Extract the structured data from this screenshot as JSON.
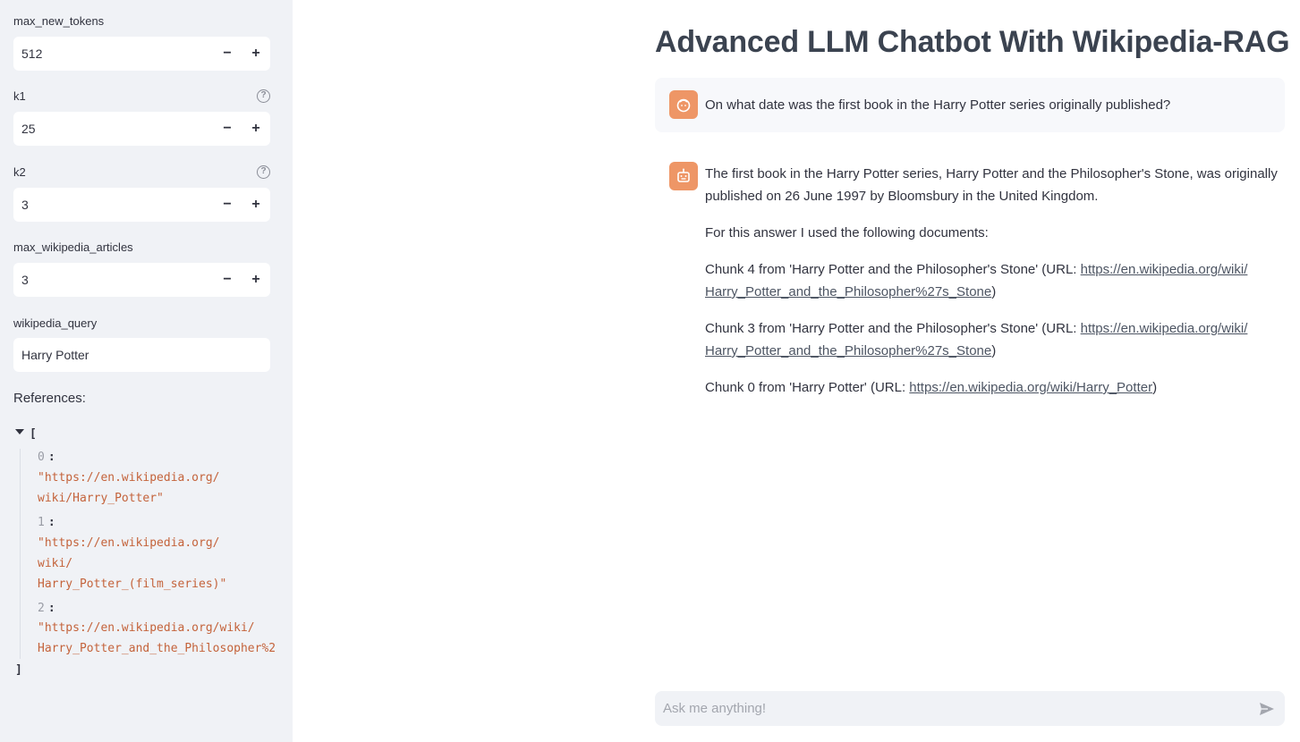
{
  "sidebar": {
    "max_new_tokens": {
      "label": "max_new_tokens",
      "value": "512"
    },
    "k1": {
      "label": "k1",
      "value": "25",
      "help": "?"
    },
    "k2": {
      "label": "k2",
      "value": "3",
      "help": "?"
    },
    "max_wikipedia_articles": {
      "label": "max_wikipedia_articles",
      "value": "3"
    },
    "wikipedia_query": {
      "label": "wikipedia_query",
      "value": "Harry Potter"
    },
    "stepper": {
      "minus": "−",
      "plus": "+"
    },
    "references": {
      "label": "References:",
      "open_bracket": "[",
      "close_bracket": "]",
      "items": [
        {
          "index": "0",
          "value": "\"https://en.wikipedia.org/\nwiki/Harry_Potter\""
        },
        {
          "index": "1",
          "value": "\"https://en.wikipedia.org/\nwiki/\nHarry_Potter_(film_series)\""
        },
        {
          "index": "2",
          "value": "\"https://en.wikipedia.org/wiki/\nHarry_Potter_and_the_Philosopher%2"
        }
      ]
    }
  },
  "main": {
    "title": "Advanced LLM Chatbot With Wikipedia-RAG",
    "user_message": "On what date was the first book in the Harry Potter series originally published?",
    "assistant": {
      "answer": "The first book in the Harry Potter series, Harry Potter and the Philosopher's Stone, was originally published on 26 June 1997 by Bloomsbury in the United Kingdom.",
      "docs_intro": "For this answer I used the following documents:",
      "sources": [
        {
          "prefix": "Chunk 4 from 'Harry Potter and the Philosopher's Stone' (URL: ",
          "url_line1": "https://en.wikipedia.org/wiki/",
          "url_line2": "Harry_Potter_and_the_Philosopher%27s_Stone",
          "suffix": ")"
        },
        {
          "prefix": "Chunk 3 from 'Harry Potter and the Philosopher's Stone' (URL: ",
          "url_line1": "https://en.wikipedia.org/wiki/",
          "url_line2": "Harry_Potter_and_the_Philosopher%27s_Stone",
          "suffix": ")"
        },
        {
          "prefix": "Chunk 0 from 'Harry Potter' (URL: ",
          "url_line1": "https://en.wikipedia.org/wiki/Harry_Potter",
          "suffix": ")"
        }
      ]
    },
    "chat_input": {
      "placeholder": "Ask me anything!"
    },
    "avatar_color": "#ee9666"
  }
}
